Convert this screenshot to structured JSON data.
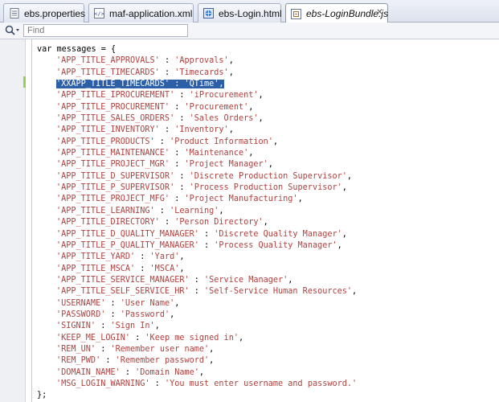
{
  "tabs": [
    {
      "label": "ebs.properties",
      "icon": "properties-file-icon",
      "active": false
    },
    {
      "label": "maf-application.xml",
      "icon": "xml-file-icon",
      "active": false
    },
    {
      "label": "ebs-Login.html",
      "icon": "html-file-icon",
      "active": false
    },
    {
      "label": "ebs-LoginBundle.js",
      "icon": "js-file-icon",
      "active": true
    }
  ],
  "find": {
    "placeholder": "Find"
  },
  "code": {
    "open_line": "var messages = {",
    "close_line": "};",
    "entries": [
      {
        "key": "'APP_TITLE_APPROVALS'",
        "value": "'Approvals'"
      },
      {
        "key": "'APP_TITLE_TIMECARDS'",
        "value": "'Timecards'"
      },
      {
        "key": "'XXAPP_TITLE_TIMECARDS'",
        "value": "'QTime'"
      },
      {
        "key": "'APP_TITLE_IPROCUREMENT'",
        "value": "'iProcurement'"
      },
      {
        "key": "'APP_TITLE_PROCUREMENT'",
        "value": "'Procurement'"
      },
      {
        "key": "'APP_TITLE_SALES_ORDERS'",
        "value": "'Sales Orders'"
      },
      {
        "key": "'APP_TITLE_INVENTORY'",
        "value": "'Inventory'"
      },
      {
        "key": "'APP_TITLE_PRODUCTS'",
        "value": "'Product Information'"
      },
      {
        "key": "'APP_TITLE_MAINTENANCE'",
        "value": "'Maintenance'"
      },
      {
        "key": "'APP_TITLE_PROJECT_MGR'",
        "value": "'Project Manager'"
      },
      {
        "key": "'APP_TITLE_D_SUPERVISOR'",
        "value": "'Discrete Production Supervisor'"
      },
      {
        "key": "'APP_TITLE_P_SUPERVISOR'",
        "value": "'Process Production Supervisor'"
      },
      {
        "key": "'APP_TITLE_PROJECT_MFG'",
        "value": "'Project Manufacturing'"
      },
      {
        "key": "'APP_TITLE_LEARNING'",
        "value": "'Learning'"
      },
      {
        "key": "'APP_TITLE_DIRECTORY'",
        "value": "'Person Directory'"
      },
      {
        "key": "'APP_TITLE_D_QUALITY_MANAGER'",
        "value": "'Discrete Quality Manager'"
      },
      {
        "key": "'APP_TITLE_P_QUALITY_MANAGER'",
        "value": "'Process Quality Manager'"
      },
      {
        "key": "'APP_TITLE_YARD'",
        "value": "'Yard'"
      },
      {
        "key": "'APP_TITLE_MSCA'",
        "value": "'MSCA'"
      },
      {
        "key": "'APP_TITLE_SERVICE_MANAGER'",
        "value": "'Service Manager'"
      },
      {
        "key": "'APP_TITLE_SELF_SERVICE_HR'",
        "value": "'Self-Service Human Resources'"
      },
      {
        "key": "'USERNAME'",
        "value": "'User Name'"
      },
      {
        "key": "'PASSWORD'",
        "value": "'Password'"
      },
      {
        "key": "'SIGNIN'",
        "value": "'Sign In'"
      },
      {
        "key": "'KEEP_ME_LOGIN'",
        "value": "'Keep me signed in'"
      },
      {
        "key": "'REM_UN'",
        "value": "'Remember user name'"
      },
      {
        "key": "'REM_PWD'",
        "value": "'Remember password'"
      },
      {
        "key": "'DOMAIN_NAME'",
        "value": "'Domain Name'"
      },
      {
        "key": "'MSG_LOGIN_WARNING'",
        "value": "'You must enter username and password.'"
      }
    ],
    "selected_entry": 2,
    "colors": {
      "string": "#b0413e",
      "selection": "#2d5fa8",
      "change_marker": "#8fd44c"
    }
  }
}
